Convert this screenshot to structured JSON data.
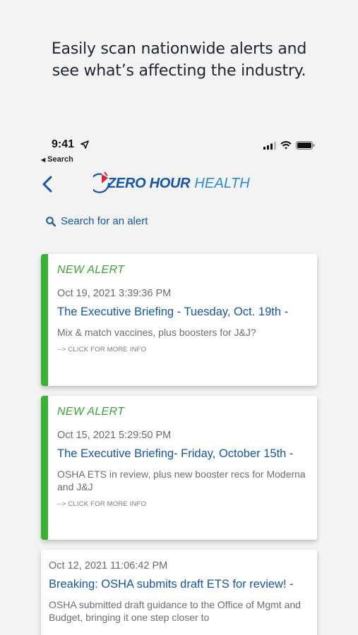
{
  "headline": {
    "line1": "Easily scan nationwide alerts and",
    "line2": "see what’s affecting the industry."
  },
  "status_bar": {
    "time": "9:41"
  },
  "nav": {
    "back_to": "Search"
  },
  "logo": {
    "zero_hour": "ZERO HOUR",
    "health": "HEALTH"
  },
  "search": {
    "label": "Search for an alert"
  },
  "colors": {
    "accent_blue": "#1656a8",
    "new_green": "#3ab036"
  },
  "alerts": [
    {
      "badge": "NEW ALERT",
      "date": "Oct 19, 2021 3:39:36 PM",
      "title": "The Executive Briefing - Tuesday, Oct. 19th -",
      "desc": "Mix & match vaccines, plus boosters for J&J?",
      "more": "--> CLICK FOR MORE INFO"
    },
    {
      "badge": "NEW ALERT",
      "date": "Oct 15, 2021 5:29:50 PM",
      "title": "The Executive Briefing- Friday, October 15th -",
      "desc": "OSHA ETS in review, plus new booster recs for Moderna and J&J",
      "more": "--> CLICK FOR MORE INFO"
    },
    {
      "date": "Oct 12, 2021 11:06:42 PM",
      "title": "Breaking: OSHA submits draft ETS for review! -",
      "desc": "OSHA submitted draft guidance to the Office of Mgmt and Budget, bringing it one step closer to"
    }
  ]
}
